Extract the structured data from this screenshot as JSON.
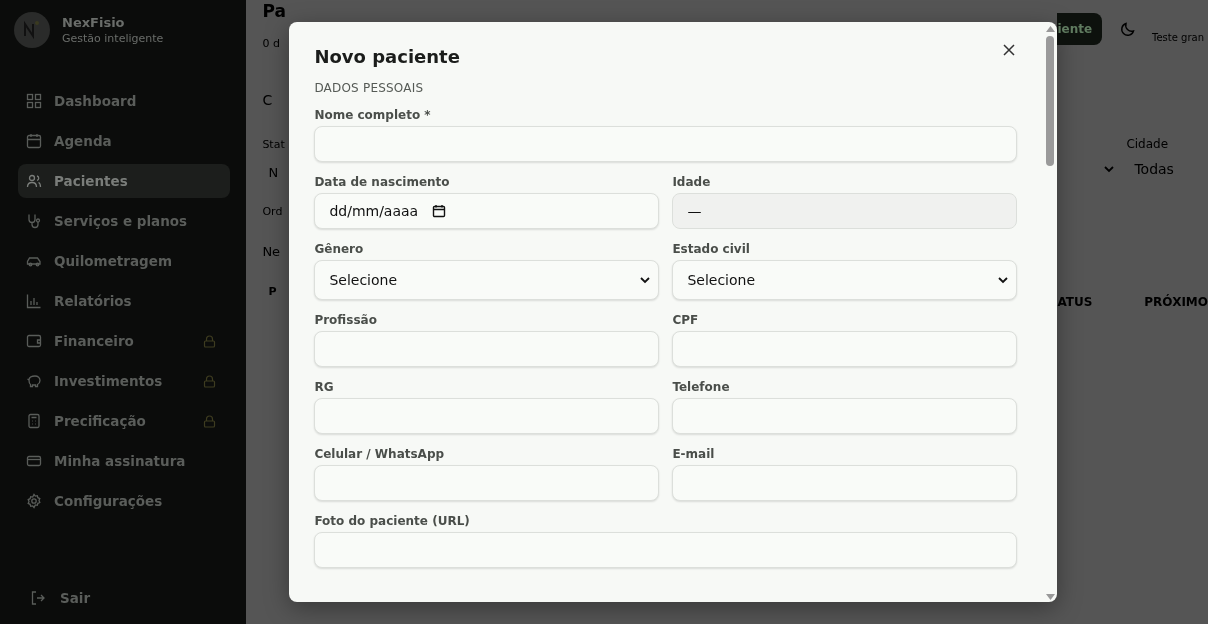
{
  "sidebar": {
    "brand": "NexFisio",
    "tagline": "Gestão inteligente",
    "items": [
      {
        "label": "Dashboard",
        "selected": false,
        "locked": false
      },
      {
        "label": "Agenda",
        "selected": false,
        "locked": false
      },
      {
        "label": "Pacientes",
        "selected": true,
        "locked": false
      },
      {
        "label": "Serviços e planos",
        "selected": false,
        "locked": false
      },
      {
        "label": "Quilometragem",
        "selected": false,
        "locked": false
      },
      {
        "label": "Relatórios",
        "selected": false,
        "locked": false
      },
      {
        "label": "Financeiro",
        "selected": false,
        "locked": true
      },
      {
        "label": "Investimentos",
        "selected": false,
        "locked": true
      },
      {
        "label": "Precificação",
        "selected": false,
        "locked": true
      },
      {
        "label": "Minha assinatura",
        "selected": false,
        "locked": false
      },
      {
        "label": "Configurações",
        "selected": false,
        "locked": false
      }
    ],
    "logout": "Sair"
  },
  "background": {
    "left": {
      "title": "Pa",
      "subtitle": "0 d",
      "tab": "C",
      "status_label": "Stat",
      "status_value": "N",
      "order_label": "Ord",
      "section": "Ne",
      "column": "P"
    },
    "right": {
      "button": "iente",
      "user": "Teste gran",
      "city_label": "Cidade",
      "city_value": "Todas",
      "column_status": "ATUS",
      "column_next": "PRÓXIMO"
    }
  },
  "dialog": {
    "title": "Novo paciente",
    "section": "DADOS PESSOAIS",
    "rows": [
      [
        {
          "kind": "text",
          "label": "Nome completo *"
        }
      ],
      [
        {
          "kind": "date",
          "label": "Data de nascimento",
          "value": "dd/mm/aaaa"
        },
        {
          "kind": "readonly",
          "label": "Idade",
          "value": "—"
        }
      ],
      [
        {
          "kind": "select",
          "label": "Gênero",
          "value": "Selecione"
        },
        {
          "kind": "select",
          "label": "Estado civil",
          "value": "Selecione"
        }
      ],
      [
        {
          "kind": "text",
          "label": "Profissão"
        },
        {
          "kind": "text",
          "label": "CPF"
        }
      ],
      [
        {
          "kind": "text",
          "label": "RG"
        },
        {
          "kind": "text",
          "label": "Telefone"
        }
      ],
      [
        {
          "kind": "text",
          "label": "Celular / WhatsApp"
        },
        {
          "kind": "text",
          "label": "E-mail"
        }
      ],
      [
        {
          "kind": "text",
          "label": "Foto do paciente (URL)"
        }
      ]
    ]
  }
}
